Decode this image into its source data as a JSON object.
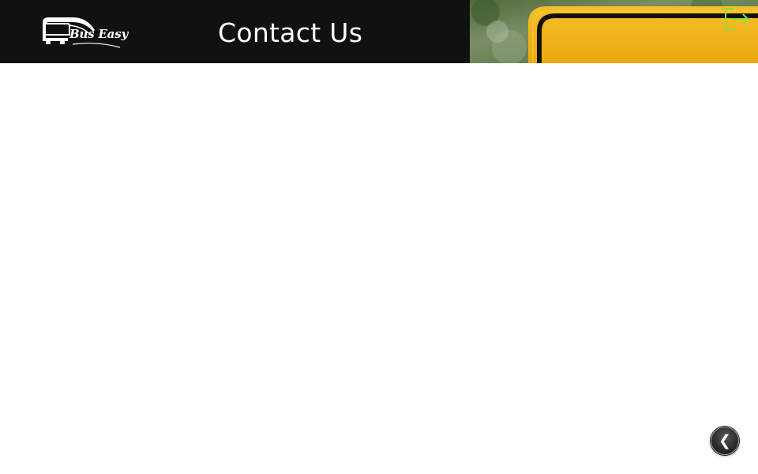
{
  "header": {
    "logo_text": "Bus Easy",
    "title": "Contact Us",
    "logout_icon": "logout-icon",
    "logout_color": "#7fe33f",
    "background_color": "#111111"
  },
  "hero": {
    "description_icon": "road-sign-image",
    "sign_color": "#f2b51c"
  },
  "footer": {
    "back_glyph": "❮",
    "back_icon": "chevron-left-icon"
  }
}
